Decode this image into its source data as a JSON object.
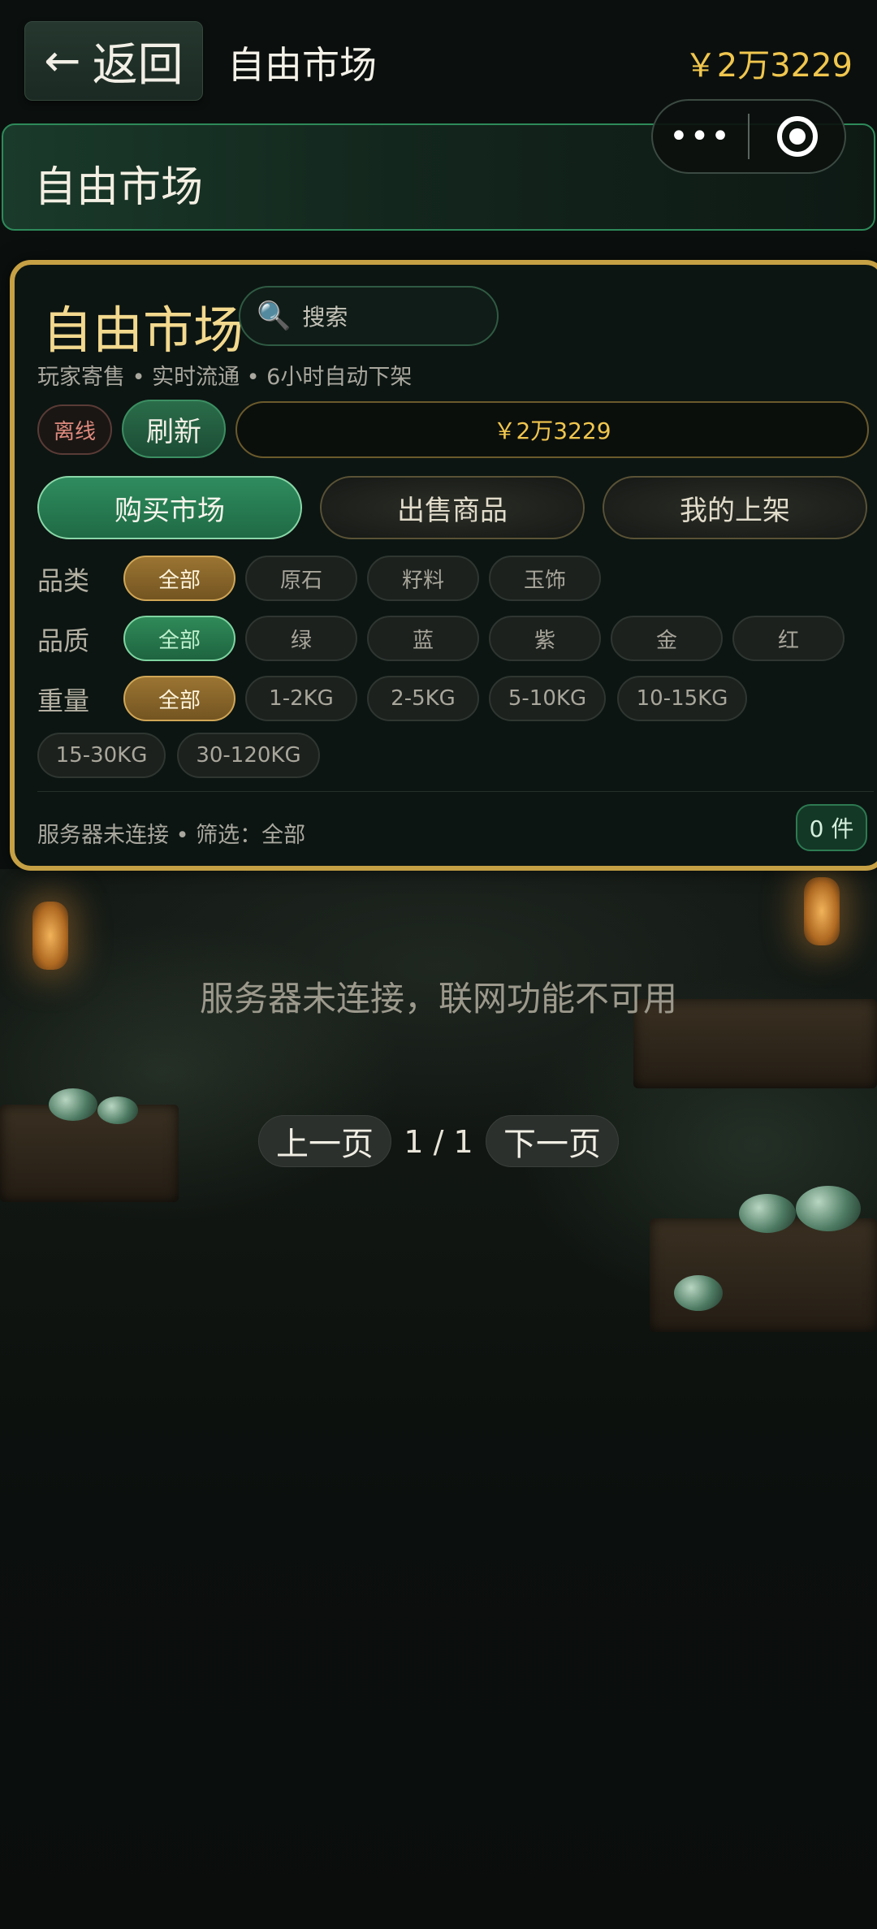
{
  "nav": {
    "back_icon": "←",
    "back_label": "返回",
    "title": "自由市场",
    "balance": "￥2万3229",
    "capsule_more_icon": "•••"
  },
  "banner": {
    "title": "自由市场"
  },
  "panel": {
    "title": "自由市场",
    "search_icon": "🔍",
    "search_placeholder": "搜索",
    "subtitle": "玩家寄售 • 实时流通 • 6小时自动下架",
    "offline_badge": "离线",
    "refresh_label": "刷新",
    "money": "￥2万3229",
    "tabs": [
      "购买市场",
      "出售商品",
      "我的上架"
    ],
    "category": {
      "label": "品类",
      "options": [
        "全部",
        "原石",
        "籽料",
        "玉饰"
      ]
    },
    "quality": {
      "label": "品质",
      "options": [
        "全部",
        "绿",
        "蓝",
        "紫",
        "金",
        "红"
      ]
    },
    "weight": {
      "label": "重量",
      "options": [
        "全部",
        "1-2KG",
        "2-5KG",
        "5-10KG",
        "10-15KG",
        "15-30KG",
        "30-120KG"
      ]
    },
    "status": "服务器未连接 • 筛选：全部",
    "count": "0 件"
  },
  "empty_message": "服务器未连接，联网功能不可用",
  "pagination": {
    "prev": "上一页",
    "page": "1 / 1",
    "next": "下一页"
  },
  "colors": {
    "gold": "#f0c64e",
    "green_accent": "#2f8c5e",
    "panel_border": "#c6a044",
    "offline": "#e08a7d"
  }
}
